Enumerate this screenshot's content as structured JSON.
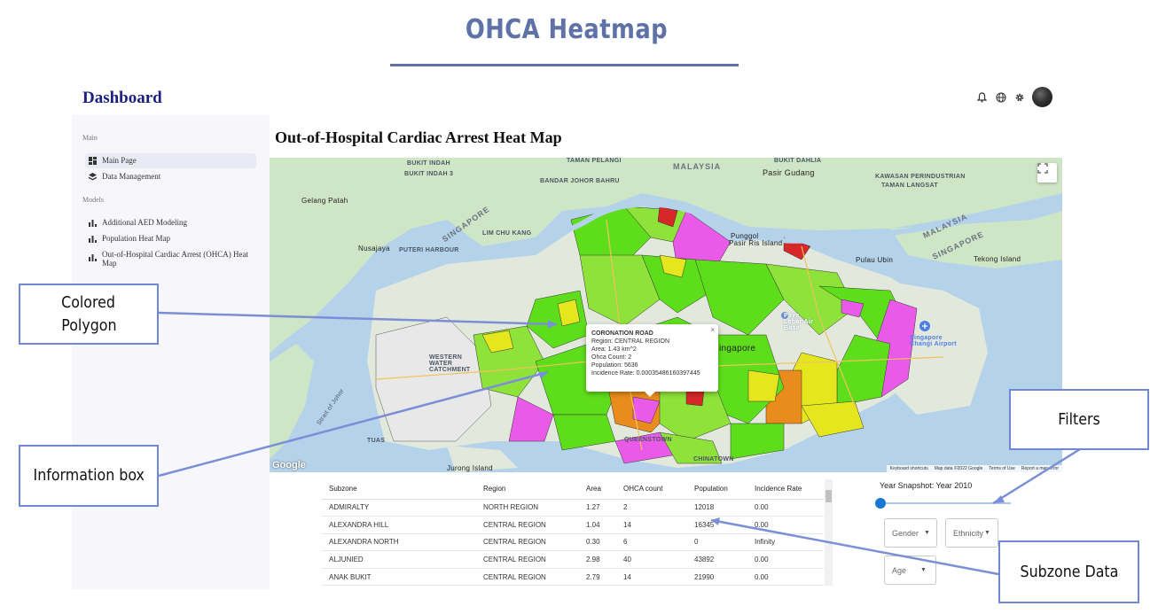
{
  "page": {
    "title": "OHCA Heatmap"
  },
  "dashboard": {
    "title": "Dashboard"
  },
  "topbar": {
    "icons": [
      "bell-icon",
      "globe-icon",
      "gear-icon",
      "avatar"
    ]
  },
  "sidebar": {
    "main_section": "Main",
    "models_section": "Models",
    "items": [
      {
        "label": "Main Page",
        "icon": "dashboard-icon",
        "active": true
      },
      {
        "label": "Data Management",
        "icon": "layers-icon"
      },
      {
        "label": "Additional AED Modeling",
        "icon": "bar-chart-icon"
      },
      {
        "label": "Population Heat Map",
        "icon": "bar-chart-icon"
      },
      {
        "label": "Out-of-Hospital Cardiac Arrest (OHCA) Heat Map",
        "icon": "bar-chart-icon"
      }
    ]
  },
  "main": {
    "title": "Out-of-Hospital Cardiac Arrest Heat Map"
  },
  "map": {
    "labels": {
      "bukit_indah": "BUKIT INDAH",
      "bukit_indah_3": "BUKIT INDAH 3",
      "taman_pelangi": "TAMAN PELANGI",
      "bandar_johor_bahru": "BANDAR JOHOR BAHRU",
      "malaysia_1": "MALAYSIA",
      "bukit_dahlia": "BUKIT DAHLIA",
      "pasir_gudang": "Pasir Gudang",
      "kawasan_perindustrian": "KAWASAN PERINDUSTRIAN",
      "taman_langsat": "TAMAN LANGSAT",
      "gelang_patah": "Gelang Patah",
      "singapore_1": "SINGAPORE",
      "lim_chu_kang": "LIM CHU KANG",
      "nusajaya": "Nusajaya",
      "puteri_harbour": "PUTERI HARBOUR",
      "punggol": "Punggol",
      "pasir_ris_island": "Pasir Ris Island",
      "pulau_ubin": "Pulau Ubin",
      "malaysia_2": "MALAYSIA",
      "singapore_2": "SINGAPORE",
      "tekong_island": "Tekong Island",
      "airbase": "Paya Lebar Air Base",
      "changi_airport": "Singapore Changi Airport",
      "western_water": "WESTERN WATER CATCHMENT",
      "tuas": "TUAS",
      "jurong_island": "Jurong Island",
      "queenstown": "QUEENSTOWN",
      "singapore_3": "Singapore",
      "chinatown": "CHINATOWN",
      "johor_strait": "Strait of Johor"
    },
    "fullscreen_icon": "fullscreen-icon",
    "google": "Google",
    "attribution": [
      "Keyboard shortcuts",
      "Map data ©2022 Google",
      "Terms of Use",
      "Report a map error"
    ],
    "colors": {
      "green": "#5ede1a",
      "light_green": "#8ee23a",
      "yellow": "#e6e61f",
      "orange": "#ea8c1c",
      "magenta": "#ea5ae8",
      "red": "#d62828",
      "grey": "#e4e4e4"
    }
  },
  "info_box": {
    "name": "CORONATION ROAD",
    "region": "Region: CENTRAL REGION",
    "area": "Area: 1.43 km^2",
    "count": "Ohca Count: 2",
    "population": "Population: 5636",
    "rate": "Incidence Rate: 0.00035486160397445",
    "close": "×"
  },
  "table": {
    "headers": [
      "Subzone",
      "Region",
      "Area",
      "OHCA count",
      "Population",
      "Incidence Rate"
    ],
    "rows": [
      [
        "ADMIRALTY",
        "NORTH REGION",
        "1.27",
        "2",
        "12018",
        "0.00"
      ],
      [
        "ALEXANDRA HILL",
        "CENTRAL REGION",
        "1.04",
        "14",
        "16345",
        "0.00"
      ],
      [
        "ALEXANDRA NORTH",
        "CENTRAL REGION",
        "0.30",
        "6",
        "0",
        "Infinity"
      ],
      [
        "ALJUNIED",
        "CENTRAL REGION",
        "2.98",
        "40",
        "43892",
        "0.00"
      ],
      [
        "ANAK BUKIT",
        "CENTRAL REGION",
        "2.79",
        "14",
        "21990",
        "0.00"
      ]
    ]
  },
  "filters": {
    "year_label": "Year Snapshot: Year 2010",
    "gender": "Gender",
    "ethnicity": "Ethnicity",
    "age": "Age"
  },
  "callouts": {
    "colored_polygon_1": "Colored",
    "colored_polygon_2": "Polygon",
    "information_box": "Information box",
    "filters": "Filters",
    "subzone_data": "Subzone Data"
  }
}
